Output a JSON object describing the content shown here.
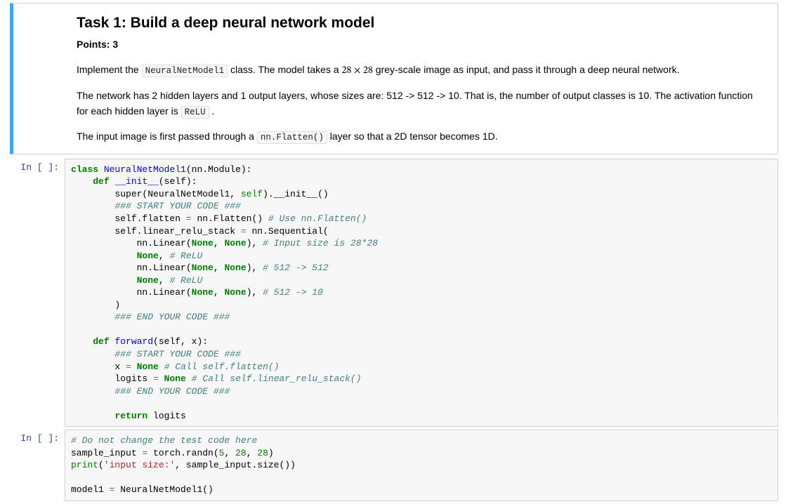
{
  "markdown": {
    "heading": "Task 1: Build a deep neural network model",
    "points_label": "Points: 3",
    "p1_a": "Implement the ",
    "p1_code": "NeuralNetModel1",
    "p1_b": " class. The model takes a ",
    "p1_math": "28 × 28",
    "p1_c": " grey-scale image as input, and pass it through a deep neural network.",
    "p2_a": "The network has 2 hidden layers and 1 output layers, whose sizes are: 512 -> 512 -> 10. That is, the number of output classes is 10. The activation function for each hidden layer is ",
    "p2_code": "ReLU",
    "p2_b": " .",
    "p3_a": "The input image is first passed through a ",
    "p3_code": "nn.Flatten()",
    "p3_b": " layer so that a 2D tensor becomes 1D."
  },
  "cell1": {
    "prompt": "In [ ]:",
    "class_kw": "class",
    "class_name": "NeuralNetModel1",
    "class_base": "(nn.Module):",
    "def_kw": "def",
    "init_name": "__init__",
    "init_sig": "(self):",
    "super_call_a": "super(NeuralNetModel1, ",
    "super_self": "self",
    "super_call_b": ").__init__()",
    "start_comment": "### START YOUR CODE ###",
    "flatten_lhs": "self.flatten ",
    "eq": "=",
    "flatten_rhs": " nn.Flatten() ",
    "flatten_com": "# Use nn.Flatten()",
    "stack_lhs": "self.linear_relu_stack ",
    "stack_rhs": " nn.Sequential(",
    "lin1_a": "nn.Linear(",
    "none": "None",
    "comma_sp": ", ",
    "lin1_b": "), ",
    "lin1_com": "# Input size is 28*28",
    "relu1_com": "# ReLU",
    "lin2_com": "# 512 -> 512",
    "lin3_com": "# 512 -> 10",
    "close_paren": ")",
    "end_comment": "### END YOUR CODE ###",
    "fwd_name": "forward",
    "fwd_sig": "(self, x):",
    "x_lhs": "x ",
    "x_com": "# Call self.flatten()",
    "logits_lhs": "logits ",
    "logits_com": "# Call self.linear_relu_stack()",
    "ret_kw": "return",
    "ret_val": " logits"
  },
  "cell2": {
    "prompt": "In [ ]:",
    "test_com": "# Do not change the test code here",
    "line2_a": "sample_input ",
    "eq": "=",
    "line2_b": " torch.randn(",
    "n5": "5",
    "n28": "28",
    "line2_c": ")",
    "print_kw": "print",
    "print_str": "'input size:'",
    "print_b": ", sample_input.size())",
    "line4_a": "model1 ",
    "line4_b": " NeuralNetModel1()"
  }
}
